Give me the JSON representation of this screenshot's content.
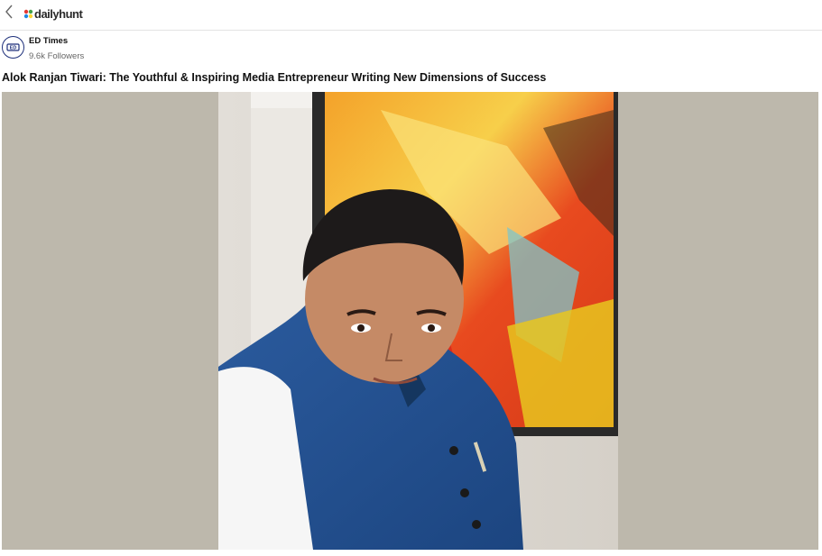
{
  "header": {
    "back_icon": "back-chevron-icon",
    "logo_text": "dailyhunt",
    "logo_colors": [
      "#e53935",
      "#43a047",
      "#1e88e5",
      "#fdd835"
    ]
  },
  "publisher": {
    "avatar_text": "ED",
    "name": "ED Times",
    "followers": "9.6k Followers"
  },
  "article": {
    "title": "Alok Ranjan Tiwari: The Youthful & Inspiring Media Entrepreneur Writing New Dimensions of Success"
  }
}
